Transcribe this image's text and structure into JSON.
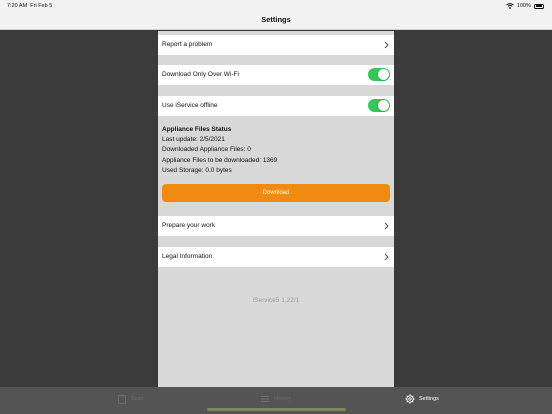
{
  "status_bar": {
    "time": "7:20 AM",
    "date": "Fri Feb 5",
    "battery": "100%"
  },
  "nav": {
    "title": "Settings"
  },
  "rows": {
    "report": "Report a problem",
    "wifi_only": "Download Only Over Wi-Fi",
    "offline": "Use iService offline",
    "prepare": "Prepare your work",
    "legal": "Legal Information"
  },
  "toggles": {
    "wifi_only": true,
    "offline": true
  },
  "appliance_files": {
    "heading": "Appliance Files Status",
    "last_update": "Last update: 2/5/2021",
    "downloaded": "Downloaded Appliance Files: 0",
    "to_download": "Appliance Files to be downloaded: 1369",
    "storage": "Used Storage: 0.0 bytes"
  },
  "download_button": "Download",
  "version": "iService5   1.22/1",
  "tabs": {
    "items": [
      {
        "label": "Scan",
        "icon": "clipboard-icon",
        "active": false
      },
      {
        "label": "History",
        "icon": "list-icon",
        "active": false
      },
      {
        "label": "Settings",
        "icon": "gear-icon",
        "active": true
      }
    ]
  },
  "colors": {
    "accent": "#f08a10",
    "toggle_on": "#34c759",
    "tabbar": "#545454",
    "background": "#3b3b3b",
    "panel": "#d8d8d8"
  }
}
